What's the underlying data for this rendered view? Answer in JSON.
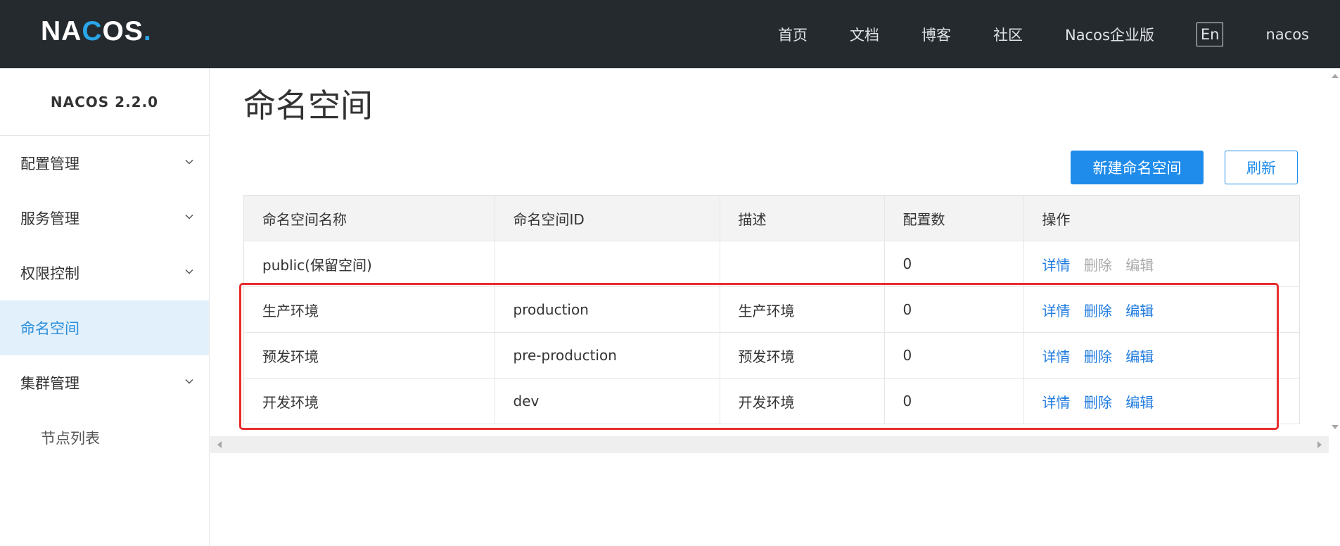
{
  "header": {
    "logo": {
      "part1": "NA",
      "part2": "C",
      "part3": "OS",
      "dot": "."
    },
    "nav": [
      "首页",
      "文档",
      "博客",
      "社区",
      "Nacos企业版"
    ],
    "lang": "En",
    "user": "nacos"
  },
  "sidebar": {
    "version": "NACOS 2.2.0",
    "items": [
      {
        "label": "配置管理",
        "expandable": true
      },
      {
        "label": "服务管理",
        "expandable": true
      },
      {
        "label": "权限控制",
        "expandable": true
      },
      {
        "label": "命名空间",
        "expandable": false,
        "active": true
      },
      {
        "label": "集群管理",
        "expandable": true
      }
    ],
    "subitems": [
      {
        "label": "节点列表"
      }
    ]
  },
  "main": {
    "title": "命名空间",
    "buttons": {
      "create": "新建命名空间",
      "refresh": "刷新"
    },
    "table": {
      "columns": [
        "命名空间名称",
        "命名空间ID",
        "描述",
        "配置数",
        "操作"
      ],
      "rows": [
        {
          "name": "public(保留空间)",
          "id": "",
          "desc": "",
          "count": "0",
          "ops": [
            {
              "label": "详情",
              "enabled": true
            },
            {
              "label": "删除",
              "enabled": false
            },
            {
              "label": "编辑",
              "enabled": false
            }
          ]
        },
        {
          "name": "生产环境",
          "id": "production",
          "desc": "生产环境",
          "count": "0",
          "ops": [
            {
              "label": "详情",
              "enabled": true
            },
            {
              "label": "删除",
              "enabled": true
            },
            {
              "label": "编辑",
              "enabled": true
            }
          ]
        },
        {
          "name": "预发环境",
          "id": "pre-production",
          "desc": "预发环境",
          "count": "0",
          "ops": [
            {
              "label": "详情",
              "enabled": true
            },
            {
              "label": "删除",
              "enabled": true
            },
            {
              "label": "编辑",
              "enabled": true
            }
          ]
        },
        {
          "name": "开发环境",
          "id": "dev",
          "desc": "开发环境",
          "count": "0",
          "ops": [
            {
              "label": "详情",
              "enabled": true
            },
            {
              "label": "删除",
              "enabled": true
            },
            {
              "label": "编辑",
              "enabled": true
            }
          ]
        }
      ]
    }
  },
  "colors": {
    "header_bg": "#252a2f",
    "accent": "#1f8ceb",
    "active_menu_bg": "#e2f0fb",
    "highlight_box": "#e82d2d"
  }
}
